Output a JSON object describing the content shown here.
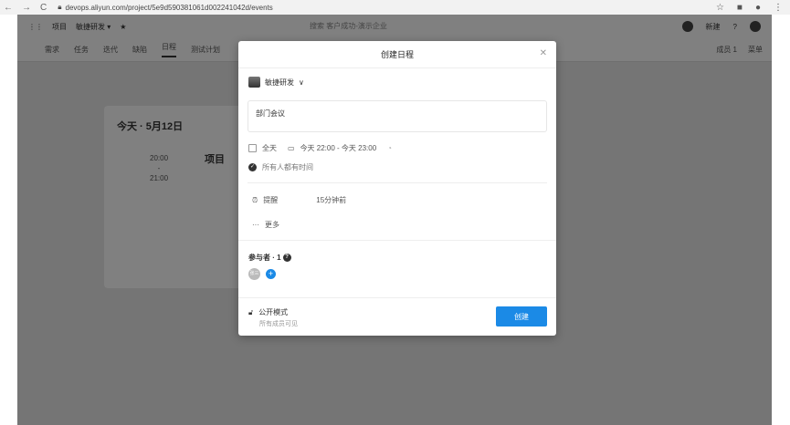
{
  "browser": {
    "url": "devops.aliyun.com/project/5e9d590381061d002241042d/events"
  },
  "app": {
    "breadcrumb": [
      "项目",
      "敏捷研发 ▾"
    ],
    "search": "搜索 客户成功-演示企业",
    "right": [
      "新建"
    ],
    "tabs": [
      "需求",
      "任务",
      "迭代",
      "缺陷",
      "日程",
      "测试计划"
    ],
    "tabs_right": [
      "成员 1",
      "菜单"
    ],
    "today": "今天 · 5月12日",
    "time_start": "20:00",
    "time_sep": "-",
    "time_end": "21:00",
    "event_title": "项目"
  },
  "modal": {
    "title": "创建日程",
    "project": "敏捷研发",
    "event_name": "部门会议",
    "all_day": "全天",
    "time_range": "今天 22:00 - 今天 23:00",
    "availability": "所有人都有时间",
    "reminder_label": "提醒",
    "reminder_value": "15分钟前",
    "more": "更多",
    "participants": "参与者 · 1",
    "participant_avatar": "张三",
    "visibility": "公开模式",
    "visibility_desc": "所有成员可见",
    "create": "创建"
  }
}
